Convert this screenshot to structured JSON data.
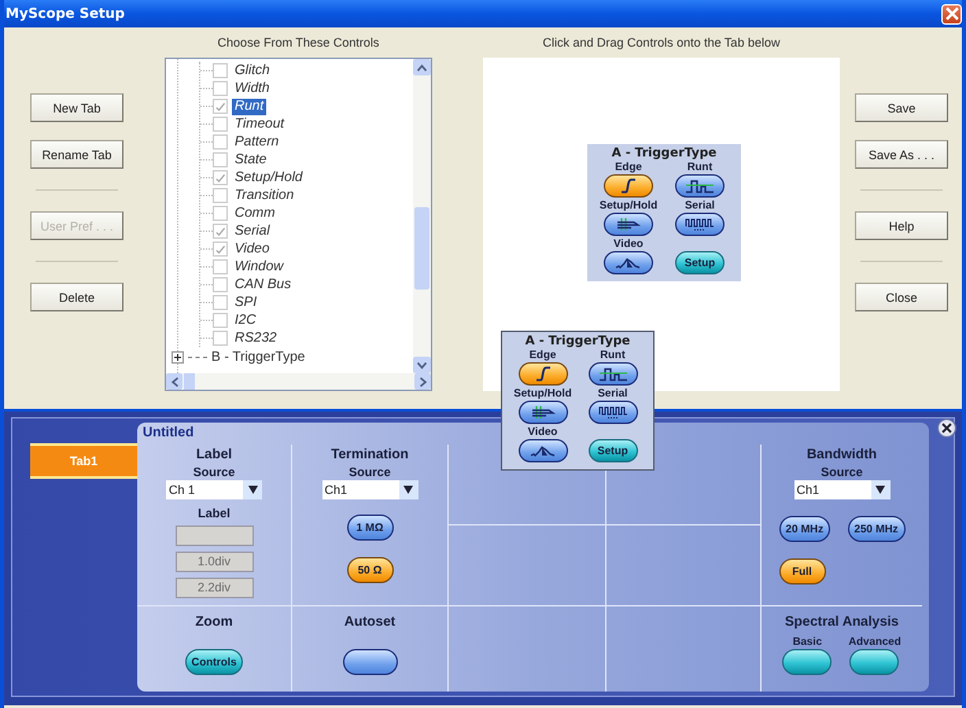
{
  "window": {
    "title": "MyScope Setup"
  },
  "left_buttons": [
    [
      {
        "label": "New Tab",
        "disabled": false
      },
      {
        "label": "Rename Tab",
        "disabled": false
      }
    ],
    [
      {
        "label": "User Pref . . .",
        "disabled": true
      }
    ],
    [
      {
        "label": "Delete",
        "disabled": false
      }
    ]
  ],
  "controls_list": {
    "heading": "Choose From These Controls",
    "items": [
      {
        "label": "Glitch",
        "checked": false,
        "selected": false
      },
      {
        "label": "Width",
        "checked": false,
        "selected": false
      },
      {
        "label": "Runt",
        "checked": true,
        "selected": true
      },
      {
        "label": "Timeout",
        "checked": false,
        "selected": false
      },
      {
        "label": "Pattern",
        "checked": false,
        "selected": false
      },
      {
        "label": "State",
        "checked": false,
        "selected": false
      },
      {
        "label": "Setup/Hold",
        "checked": true,
        "selected": false
      },
      {
        "label": "Transition",
        "checked": false,
        "selected": false
      },
      {
        "label": "Comm",
        "checked": false,
        "selected": false
      },
      {
        "label": "Serial",
        "checked": true,
        "selected": false
      },
      {
        "label": "Video",
        "checked": true,
        "selected": false
      },
      {
        "label": "Window",
        "checked": false,
        "selected": false
      },
      {
        "label": "CAN Bus",
        "checked": false,
        "selected": false
      },
      {
        "label": "SPI",
        "checked": false,
        "selected": false
      },
      {
        "label": "I2C",
        "checked": false,
        "selected": false
      },
      {
        "label": "RS232",
        "checked": false,
        "selected": false
      }
    ],
    "collapsed_node": {
      "label": "B - TriggerType",
      "expanded": false
    }
  },
  "canvas": {
    "heading": "Click and Drag Controls onto the Tab below",
    "widget": {
      "title": "A - TriggerType",
      "items": [
        {
          "caption": "Edge",
          "kind": "mode",
          "selected": true
        },
        {
          "caption": "Runt",
          "kind": "mode",
          "selected": false
        },
        {
          "caption": "Setup/Hold",
          "kind": "mode",
          "selected": false
        },
        {
          "caption": "Serial",
          "kind": "mode",
          "selected": false
        },
        {
          "caption": "Video",
          "kind": "mode",
          "selected": false
        },
        {
          "kind": "action",
          "label": "Setup"
        }
      ]
    }
  },
  "right_buttons": [
    [
      {
        "label": "Save",
        "disabled": false
      },
      {
        "label": "Save As . . .",
        "disabled": false
      }
    ],
    [
      {
        "label": "Help",
        "disabled": false
      }
    ],
    [
      {
        "label": "Close",
        "disabled": false
      }
    ]
  ],
  "dragged_widget": {
    "title": "A - TriggerType",
    "items": [
      {
        "caption": "Edge",
        "kind": "mode",
        "selected": true
      },
      {
        "caption": "Runt",
        "kind": "mode",
        "selected": false
      },
      {
        "caption": "Setup/Hold",
        "kind": "mode",
        "selected": false
      },
      {
        "caption": "Serial",
        "kind": "mode",
        "selected": false
      },
      {
        "caption": "Video",
        "kind": "mode",
        "selected": false
      },
      {
        "kind": "action",
        "label": "Setup"
      }
    ]
  },
  "tab_editor": {
    "tabs": [
      {
        "label": "Tab1",
        "selected": true
      }
    ],
    "panel_title": "Untitled",
    "label_section": {
      "title": "Label",
      "source_label": "Source",
      "source_value": "Ch 1",
      "field_label": "Label",
      "fields": [
        {
          "disabled": true
        },
        {
          "value": "1.0div",
          "disabled": true
        },
        {
          "value": "2.2div",
          "disabled": true
        }
      ]
    },
    "termination_section": {
      "title": "Termination",
      "source_label": "Source",
      "source_value": "Ch1",
      "buttons": [
        {
          "label": "1 MΩ",
          "kind": "mode",
          "selected": false
        },
        {
          "label": "50 Ω",
          "kind": "mode",
          "selected": true
        }
      ]
    },
    "bandwidth_section": {
      "title": "Bandwidth",
      "source_label": "Source",
      "source_value": "Ch1",
      "buttons": [
        {
          "label": "20 MHz",
          "kind": "mode",
          "selected": false
        },
        {
          "label": "250 MHz",
          "kind": "mode",
          "selected": false
        },
        {
          "label": "Full",
          "kind": "mode",
          "selected": true
        }
      ]
    },
    "zoom_section": {
      "title": "Zoom",
      "button": {
        "label": "Controls",
        "kind": "action"
      }
    },
    "autoset_section": {
      "title": "Autoset",
      "button": {
        "kind": "mode",
        "selected": false
      }
    },
    "spectral_section": {
      "title": "Spectral Analysis",
      "options": [
        {
          "caption": "Basic",
          "kind": "action"
        },
        {
          "caption": "Advanced",
          "kind": "action"
        }
      ]
    }
  }
}
